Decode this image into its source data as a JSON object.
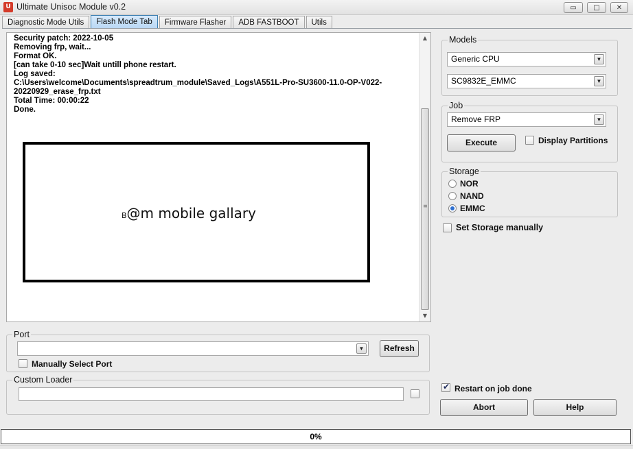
{
  "window": {
    "title": "Ultimate Unisoc Module v0.2",
    "controls": {
      "minimize": "▭",
      "maximize": "□",
      "close": "✕"
    }
  },
  "tabs": [
    {
      "label": "Diagnostic  Mode Utils",
      "active": false
    },
    {
      "label": "Flash Mode Tab",
      "active": true
    },
    {
      "label": "Firmware Flasher",
      "active": false
    },
    {
      "label": "ADB FASTBOOT",
      "active": false
    },
    {
      "label": "Utils",
      "active": false
    }
  ],
  "log": {
    "lines": [
      "Security patch: 2022-10-05",
      "Removing frp, wait...",
      "Format OK.",
      "[can take 0-10 sec]Wait untill phone restart.",
      "Log saved:",
      "C:\\Users\\welcome\\Documents\\spreadtrum_module\\Saved_Logs\\A551L-Pro-SU3600-11.0-OP-V022-",
      "20220929_erase_frp.txt",
      "Total Time: 00:00:22",
      "Done."
    ],
    "watermark_prefix": "B",
    "watermark_text": "@m mobile gallary"
  },
  "models": {
    "legend": "Models",
    "cpu_value": "Generic CPU",
    "chip_value": "SC9832E_EMMC"
  },
  "job": {
    "legend": "Job",
    "job_value": "Remove FRP",
    "execute_label": "Execute",
    "display_partitions_label": "Display Partitions",
    "display_partitions_checked": false
  },
  "storage": {
    "legend": "Storage",
    "options": [
      {
        "label": "NOR",
        "selected": false
      },
      {
        "label": "NAND",
        "selected": false
      },
      {
        "label": "EMMC",
        "selected": true
      }
    ],
    "set_manually_label": "Set Storage manually",
    "set_manually_checked": false
  },
  "port": {
    "legend": "Port",
    "value": "",
    "refresh_label": "Refresh",
    "manual_label": "Manually Select Port",
    "manual_checked": false
  },
  "custom_loader": {
    "legend": "Custom Loader",
    "value": "",
    "checked": false
  },
  "actions": {
    "restart_label": "Restart on job done",
    "restart_checked": true,
    "abort_label": "Abort",
    "help_label": "Help"
  },
  "progress": {
    "value": 0,
    "text": "0%"
  },
  "icons": {
    "app": "app-logo-icon",
    "dropdown": "chevron-down-icon",
    "scroll_up": "arrow-up-icon",
    "scroll_down": "arrow-down-icon"
  },
  "colors": {
    "active_tab": "#b8d7f4",
    "active_tab_border": "#3c7fb1",
    "radio_selected": "#2e6fcf"
  }
}
